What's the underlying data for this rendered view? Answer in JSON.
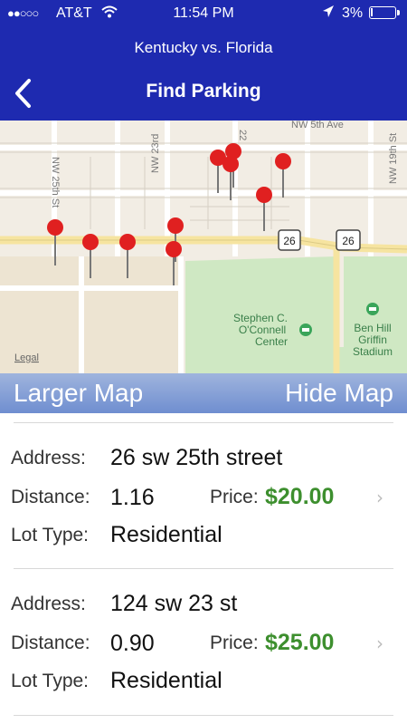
{
  "status_bar": {
    "signal": "●●○○○",
    "carrier": "AT&T",
    "time": "11:54 PM",
    "battery": "3%"
  },
  "header": {
    "subtitle": "Kentucky vs. Florida",
    "title": "Find Parking"
  },
  "map": {
    "labels": {
      "nw5": "NW 5th Ave",
      "nw25": "NW 25th St",
      "nw23": "NW 23rd",
      "nw22": "22",
      "nw19": "NW 19th St",
      "route1": "26",
      "route2": "26",
      "oconnell": [
        "Stephen C.",
        "O'Connell",
        "Center"
      ],
      "stadium": [
        "Ben Hill",
        "Griffin",
        "Stadium"
      ],
      "legal": "Legal"
    }
  },
  "map_bar": {
    "larger": "Larger Map",
    "hide": "Hide Map"
  },
  "listings": [
    {
      "address_label": "Address:",
      "address": "26 sw 25th street",
      "distance_label": "Distance:",
      "distance": "1.16",
      "price_label": "Price:",
      "price": "$20.00",
      "lot_label": "Lot Type:",
      "lot": "Residential"
    },
    {
      "address_label": "Address:",
      "address": "124 sw 23 st",
      "distance_label": "Distance:",
      "distance": "0.90",
      "price_label": "Price:",
      "price": "$25.00",
      "lot_label": "Lot Type:",
      "lot": "Residential"
    }
  ],
  "colors": {
    "header": "#1e2ab0",
    "price": "#3d8f2e",
    "pin": "#e02020",
    "park": "#cfe8c3"
  },
  "icons": [
    "wifi-icon",
    "location-arrow-icon",
    "battery-icon",
    "back-chevron-icon",
    "map-pin-icon",
    "disclosure-chevron-icon",
    "park-icon"
  ]
}
